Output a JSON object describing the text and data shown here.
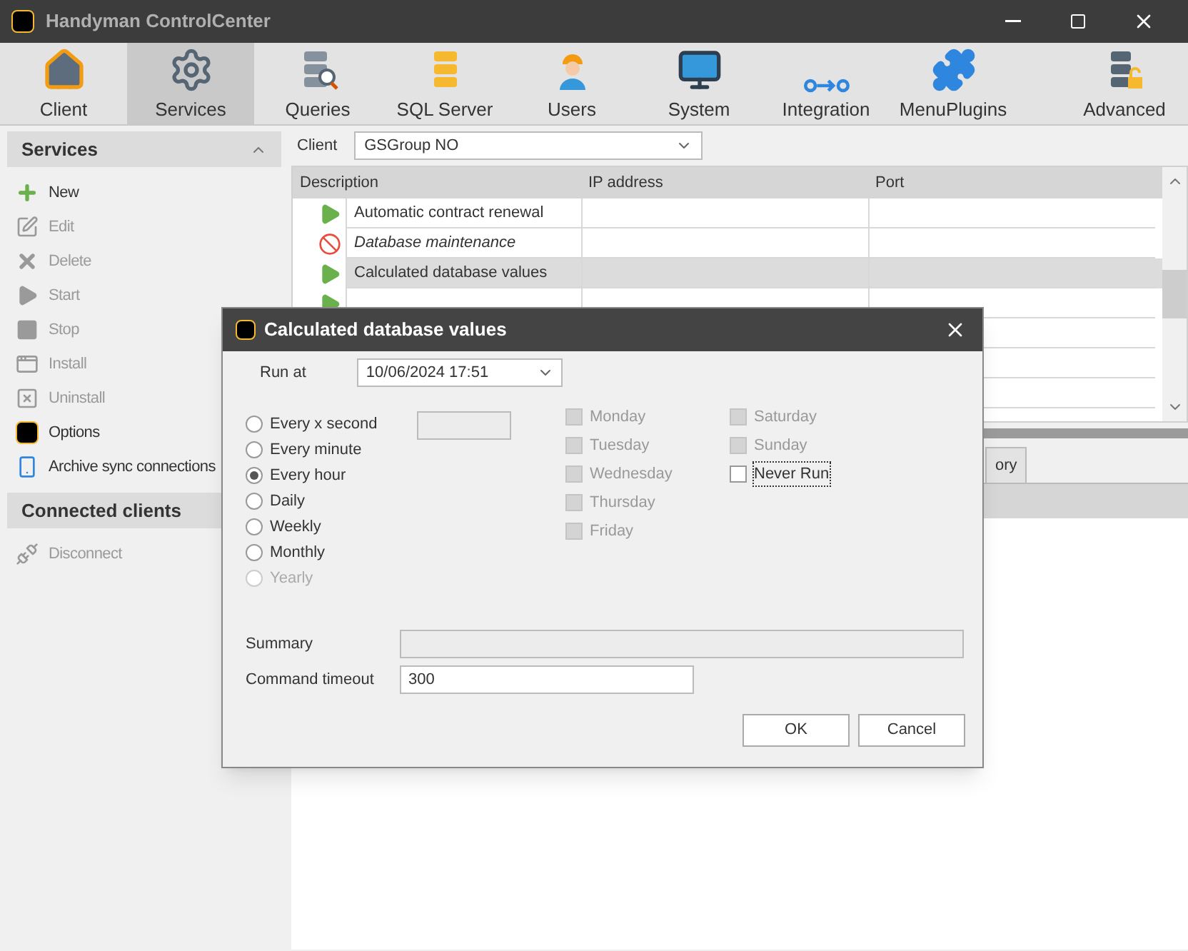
{
  "window": {
    "title": "Handyman ControlCenter"
  },
  "toolbar": [
    {
      "label": "Client",
      "kind": "home",
      "selected": false
    },
    {
      "label": "Services",
      "kind": "gears",
      "selected": true
    },
    {
      "label": "Queries",
      "kind": "queries",
      "selected": false
    },
    {
      "label": "SQL Server",
      "kind": "sql",
      "selected": false
    },
    {
      "label": "Users",
      "kind": "user",
      "selected": false
    },
    {
      "label": "System",
      "kind": "system",
      "selected": false
    },
    {
      "label": "Integration",
      "kind": "integration",
      "selected": false
    },
    {
      "label": "MenuPlugins",
      "kind": "plugin",
      "selected": false
    },
    {
      "label": "Advanced",
      "kind": "advanced",
      "selected": false
    }
  ],
  "sidebar": {
    "sections": [
      {
        "title": "Services",
        "expanded": true,
        "items": [
          {
            "label": "New",
            "kind": "new",
            "disabled": false
          },
          {
            "label": "Edit",
            "kind": "edit",
            "disabled": true
          },
          {
            "label": "Delete",
            "kind": "delete",
            "disabled": true
          },
          {
            "label": "Start",
            "kind": "start",
            "disabled": true
          },
          {
            "label": "Stop",
            "kind": "stop",
            "disabled": true
          },
          {
            "label": "Install",
            "kind": "install",
            "disabled": true
          },
          {
            "label": "Uninstall",
            "kind": "uninstall",
            "disabled": true
          },
          {
            "label": "Options",
            "kind": "options",
            "disabled": false
          },
          {
            "label": "Archive sync connections",
            "kind": "archive",
            "disabled": false
          }
        ]
      },
      {
        "title": "Connected clients",
        "items": [
          {
            "label": "Disconnect",
            "kind": "disconnect",
            "disabled": true
          }
        ]
      }
    ]
  },
  "client": {
    "label": "Client",
    "value": "GSGroup NO"
  },
  "table": {
    "columns": [
      "Description",
      "IP address",
      "Port"
    ],
    "rows": [
      {
        "kind": "running",
        "description": "Automatic contract renewal",
        "selected": false
      },
      {
        "kind": "blocked",
        "description": "Database maintenance",
        "selected": false
      },
      {
        "kind": "running",
        "description": "Calculated database values",
        "selected": true
      },
      {
        "kind": "running",
        "selected": false
      }
    ]
  },
  "bottom_tabs": [
    {
      "label": "ory",
      "selected": false
    }
  ],
  "dialog": {
    "title": "Calculated database values",
    "run_at": {
      "label": "Run at",
      "value": "10/06/2024 17:51"
    },
    "schedule": [
      {
        "label": "Every x second",
        "selected": false,
        "disabled": false
      },
      {
        "label": "Every minute",
        "selected": false,
        "disabled": false
      },
      {
        "label": "Every hour",
        "selected": true,
        "disabled": false
      },
      {
        "label": "Daily",
        "selected": false,
        "disabled": false
      },
      {
        "label": "Weekly",
        "selected": false,
        "disabled": false
      },
      {
        "label": "Monthly",
        "selected": false,
        "disabled": false
      },
      {
        "label": "Yearly",
        "selected": false,
        "disabled": true
      }
    ],
    "interval_field": {
      "disabled": true
    },
    "days": [
      {
        "label": "Monday",
        "checked": false,
        "disabled": true
      },
      {
        "label": "Tuesday",
        "checked": false,
        "disabled": true
      },
      {
        "label": "Wednesday",
        "checked": false,
        "disabled": true
      },
      {
        "label": "Thursday",
        "checked": false,
        "disabled": true
      },
      {
        "label": "Friday",
        "checked": false,
        "disabled": true
      },
      {
        "label": "Saturday",
        "checked": false,
        "disabled": true
      },
      {
        "label": "Sunday",
        "checked": false,
        "disabled": true
      },
      {
        "label": "Never Run",
        "checked": false,
        "disabled": false,
        "focused": true
      }
    ],
    "summary": {
      "label": "Summary",
      "disabled": true
    },
    "timeout": {
      "label": "Command timeout",
      "value": "300"
    },
    "buttons": [
      "OK",
      "Cancel"
    ]
  }
}
